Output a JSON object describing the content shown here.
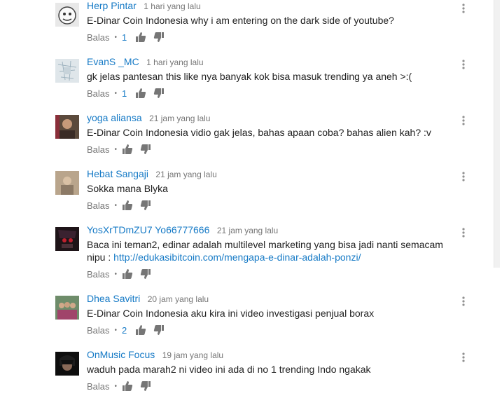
{
  "colors": {
    "author": "#167ac6",
    "meta": "#767676",
    "text": "#222222",
    "icon": "#767676"
  },
  "comments": [
    {
      "author": "Herp Pintar",
      "time": "1 hari yang lalu",
      "text": "E-Dinar Coin Indonesia why i am entering on the dark side of youtube?",
      "reply": "Balas",
      "likes": "1",
      "like_icon": "thumbs-up-icon",
      "dislike_icon": "thumbs-down-icon",
      "avatar_icon": "cartoon-face-avatar"
    },
    {
      "author": "EvanS _MC",
      "time": "1 hari yang lalu",
      "text": "gk jelas pantesan this like nya banyak kok bisa masuk trending ya aneh >:(",
      "reply": "Balas",
      "likes": "1",
      "avatar_icon": "sketch-avatar"
    },
    {
      "author": "yoga aliansa",
      "time": "21 jam yang lalu",
      "text": "E-Dinar Coin Indonesia vidio gak jelas, bahas apaan coba? bahas alien kah? :v",
      "reply": "Balas",
      "likes": "",
      "avatar_icon": "person-photo-avatar"
    },
    {
      "author": "Hebat Sangaji",
      "time": "21 jam yang lalu",
      "text": "Sokka mana Blyka",
      "reply": "Balas",
      "likes": "",
      "avatar_icon": "group-photo-avatar"
    },
    {
      "author": "YosXrTDmZU7 Yo66777666",
      "time": "21 jam yang lalu",
      "text": "Baca ini teman2, edinar adalah multilevel marketing yang bisa jadi nanti semacam nipu : ",
      "link": "http://edukasibitcoin.com/mengapa-e-dinar-adalah-ponzi/",
      "reply": "Balas",
      "likes": "",
      "avatar_icon": "anime-avatar"
    },
    {
      "author": "Dhea Savitri",
      "time": "20 jam yang lalu",
      "text": "E-Dinar Coin Indonesia aku kira ini video investigasi penjual borax",
      "reply": "Balas",
      "likes": "2",
      "avatar_icon": "group-photo-avatar"
    },
    {
      "author": "OnMusic Focus",
      "time": "19 jam yang lalu",
      "text": "waduh pada marah2 ni video ini ada di no 1 trending Indo ngakak",
      "reply": "Balas",
      "likes": "",
      "avatar_icon": "dark-portrait-avatar"
    }
  ]
}
